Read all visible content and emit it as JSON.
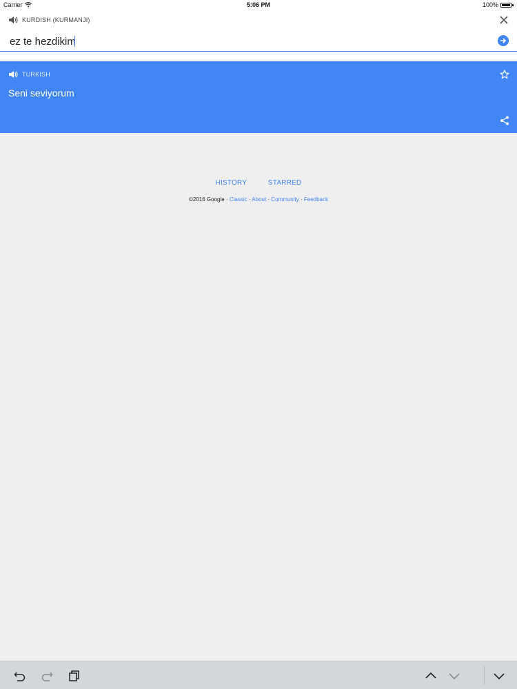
{
  "status_bar": {
    "carrier": "Carrier",
    "time": "5:06 PM",
    "battery": "100%"
  },
  "source": {
    "language": "KURDISH (KURMANJI)",
    "text": "ez te hezdikim"
  },
  "result": {
    "language": "TURKISH",
    "text": "Seni seviyorum"
  },
  "links": {
    "history": "HISTORY",
    "starred": "STARRED"
  },
  "footer": {
    "copyright": "©2016 Google",
    "sep": " · ",
    "classic": "Classic",
    "about": "About",
    "community": "Community",
    "feedback": "Feedback"
  },
  "colors": {
    "accent": "#4285f4",
    "background": "#efefef",
    "toolbar": "#d3d6db"
  },
  "icons": {
    "speaker": "speaker-icon",
    "close": "close-icon",
    "go": "arrow-right-circle-icon",
    "star": "star-outline-icon",
    "share": "share-icon",
    "undo": "undo-icon",
    "redo": "redo-icon",
    "paste": "clipboard-icon",
    "up": "chevron-up-icon",
    "down": "chevron-down-icon",
    "hide_keyboard": "chevron-down-icon"
  }
}
